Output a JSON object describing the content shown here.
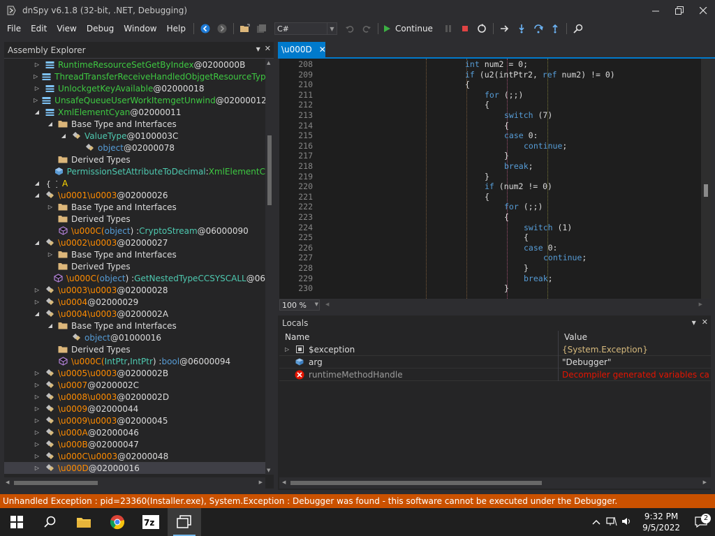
{
  "window": {
    "title": "dnSpy v6.1.8 (32-bit, .NET, Debugging)",
    "controls": [
      "minimize",
      "restore",
      "close"
    ]
  },
  "menu": [
    "File",
    "Edit",
    "View",
    "Debug",
    "Window",
    "Help"
  ],
  "toolbar": {
    "language": "C#",
    "continue_label": "Continue"
  },
  "assembly_explorer": {
    "title": "Assembly Explorer",
    "rows": [
      {
        "indent": 1,
        "tri": "▷",
        "icon": "class",
        "parts": [
          {
            "t": "RuntimeResourceSetGetByIndex",
            "c": "c-gr2"
          },
          {
            "t": " @0200000B",
            "c": "c-white"
          }
        ]
      },
      {
        "indent": 1,
        "tri": "▷",
        "icon": "class",
        "parts": [
          {
            "t": "ThreadTransferReceiveHandledObjgetResourceTypeI",
            "c": "c-gr2"
          }
        ]
      },
      {
        "indent": 1,
        "tri": "▷",
        "icon": "class",
        "parts": [
          {
            "t": "UnlockgetKeyAvailable",
            "c": "c-gr2"
          },
          {
            "t": " @02000018",
            "c": "c-white"
          }
        ]
      },
      {
        "indent": 1,
        "tri": "▷",
        "icon": "class",
        "parts": [
          {
            "t": "UnsafeQueueUserWorkItemgetUnwind",
            "c": "c-gr2"
          },
          {
            "t": " @02000012",
            "c": "c-white"
          }
        ]
      },
      {
        "indent": 1,
        "tri": "◢",
        "icon": "class",
        "parts": [
          {
            "t": "XmlElementCyan",
            "c": "c-gr2"
          },
          {
            "t": " @02000011",
            "c": "c-white"
          }
        ]
      },
      {
        "indent": 2,
        "tri": "◢",
        "icon": "folder",
        "parts": [
          {
            "t": "Base Type and Interfaces",
            "c": "c-white"
          }
        ]
      },
      {
        "indent": 3,
        "tri": "◢",
        "icon": "struct",
        "parts": [
          {
            "t": "ValueType",
            "c": "c-teal"
          },
          {
            "t": " @0100003C",
            "c": "c-white"
          }
        ]
      },
      {
        "indent": 4,
        "tri": "",
        "icon": "struct",
        "parts": [
          {
            "t": "object",
            "c": "c-blue"
          },
          {
            "t": " @02000078",
            "c": "c-white"
          }
        ]
      },
      {
        "indent": 2,
        "tri": "",
        "icon": "folder",
        "parts": [
          {
            "t": "Derived Types",
            "c": "c-white"
          }
        ]
      },
      {
        "indent": 2,
        "tri": "",
        "icon": "method",
        "parts": [
          {
            "t": "PermissionSetAttributeToDecimal",
            "c": "c-teal"
          },
          {
            "t": " : ",
            "c": "c-white"
          },
          {
            "t": "XmlElementC",
            "c": "c-gr2"
          }
        ]
      },
      {
        "indent": 0,
        "tri": "◢",
        "icon": "namespace",
        "parts": [
          {
            "t": "A",
            "c": "c-ns"
          }
        ]
      },
      {
        "indent": 1,
        "tri": "◢",
        "icon": "struct",
        "parts": [
          {
            "t": "\\u0001\\u0003",
            "c": "c-orange"
          },
          {
            "t": " @02000026",
            "c": "c-white"
          }
        ]
      },
      {
        "indent": 2,
        "tri": "▷",
        "icon": "folder",
        "parts": [
          {
            "t": "Base Type and Interfaces",
            "c": "c-white"
          }
        ]
      },
      {
        "indent": 2,
        "tri": "",
        "icon": "folder",
        "parts": [
          {
            "t": "Derived Types",
            "c": "c-white"
          }
        ]
      },
      {
        "indent": 2,
        "tri": "",
        "icon": "ctor",
        "parts": [
          {
            "t": "\\u000C(",
            "c": "c-orange"
          },
          {
            "t": "object",
            "c": "c-blue"
          },
          {
            "t": ") : ",
            "c": "c-white"
          },
          {
            "t": "CryptoStream",
            "c": "c-teal"
          },
          {
            "t": " @06000090",
            "c": "c-white"
          }
        ]
      },
      {
        "indent": 1,
        "tri": "◢",
        "icon": "struct",
        "parts": [
          {
            "t": "\\u0002\\u0003",
            "c": "c-orange"
          },
          {
            "t": " @02000027",
            "c": "c-white"
          }
        ]
      },
      {
        "indent": 2,
        "tri": "▷",
        "icon": "folder",
        "parts": [
          {
            "t": "Base Type and Interfaces",
            "c": "c-white"
          }
        ]
      },
      {
        "indent": 2,
        "tri": "",
        "icon": "folder",
        "parts": [
          {
            "t": "Derived Types",
            "c": "c-white"
          }
        ]
      },
      {
        "indent": 2,
        "tri": "",
        "icon": "ctor",
        "parts": [
          {
            "t": "\\u000C(",
            "c": "c-orange"
          },
          {
            "t": "object",
            "c": "c-blue"
          },
          {
            "t": ") : ",
            "c": "c-white"
          },
          {
            "t": "GetNestedTypeCCSYSCALL",
            "c": "c-teal"
          },
          {
            "t": " @06",
            "c": "c-white"
          }
        ]
      },
      {
        "indent": 1,
        "tri": "▷",
        "icon": "struct",
        "parts": [
          {
            "t": "\\u0003\\u0003",
            "c": "c-orange"
          },
          {
            "t": " @02000028",
            "c": "c-white"
          }
        ]
      },
      {
        "indent": 1,
        "tri": "▷",
        "icon": "struct",
        "parts": [
          {
            "t": "\\u0004",
            "c": "c-orange"
          },
          {
            "t": " @02000029",
            "c": "c-white"
          }
        ]
      },
      {
        "indent": 1,
        "tri": "◢",
        "icon": "struct",
        "parts": [
          {
            "t": "\\u0004\\u0003",
            "c": "c-orange"
          },
          {
            "t": " @0200002A",
            "c": "c-white"
          }
        ]
      },
      {
        "indent": 2,
        "tri": "◢",
        "icon": "folder",
        "parts": [
          {
            "t": "Base Type and Interfaces",
            "c": "c-white"
          }
        ]
      },
      {
        "indent": 3,
        "tri": "",
        "icon": "struct",
        "parts": [
          {
            "t": "object",
            "c": "c-blue"
          },
          {
            "t": " @01000016",
            "c": "c-white"
          }
        ]
      },
      {
        "indent": 2,
        "tri": "",
        "icon": "folder",
        "parts": [
          {
            "t": "Derived Types",
            "c": "c-white"
          }
        ]
      },
      {
        "indent": 2,
        "tri": "",
        "icon": "ctor",
        "parts": [
          {
            "t": "\\u000C(",
            "c": "c-orange"
          },
          {
            "t": "IntPtr",
            "c": "c-teal"
          },
          {
            "t": ", ",
            "c": "c-white"
          },
          {
            "t": "IntPtr",
            "c": "c-teal"
          },
          {
            "t": ") : ",
            "c": "c-white"
          },
          {
            "t": "bool",
            "c": "c-blue"
          },
          {
            "t": " @06000094",
            "c": "c-white"
          }
        ]
      },
      {
        "indent": 1,
        "tri": "▷",
        "icon": "struct",
        "parts": [
          {
            "t": "\\u0005\\u0003",
            "c": "c-orange"
          },
          {
            "t": " @0200002B",
            "c": "c-white"
          }
        ]
      },
      {
        "indent": 1,
        "tri": "▷",
        "icon": "struct",
        "parts": [
          {
            "t": "\\u0007",
            "c": "c-orange"
          },
          {
            "t": " @0200002C",
            "c": "c-white"
          }
        ]
      },
      {
        "indent": 1,
        "tri": "▷",
        "icon": "struct",
        "parts": [
          {
            "t": "\\u0008\\u0003",
            "c": "c-orange"
          },
          {
            "t": " @0200002D",
            "c": "c-white"
          }
        ]
      },
      {
        "indent": 1,
        "tri": "▷",
        "icon": "struct",
        "parts": [
          {
            "t": "\\u0009",
            "c": "c-orange"
          },
          {
            "t": " @02000044",
            "c": "c-white"
          }
        ]
      },
      {
        "indent": 1,
        "tri": "▷",
        "icon": "struct",
        "parts": [
          {
            "t": "\\u0009\\u0003",
            "c": "c-orange"
          },
          {
            "t": " @02000045",
            "c": "c-white"
          }
        ]
      },
      {
        "indent": 1,
        "tri": "▷",
        "icon": "struct",
        "parts": [
          {
            "t": "\\u000A",
            "c": "c-orange"
          },
          {
            "t": " @02000046",
            "c": "c-white"
          }
        ]
      },
      {
        "indent": 1,
        "tri": "▷",
        "icon": "struct",
        "parts": [
          {
            "t": "\\u000B",
            "c": "c-orange"
          },
          {
            "t": " @02000047",
            "c": "c-white"
          }
        ]
      },
      {
        "indent": 1,
        "tri": "▷",
        "icon": "struct",
        "parts": [
          {
            "t": "\\u000C\\u0003",
            "c": "c-orange"
          },
          {
            "t": " @02000048",
            "c": "c-white"
          }
        ]
      },
      {
        "indent": 1,
        "tri": "▷",
        "icon": "struct",
        "selected": true,
        "parts": [
          {
            "t": "\\u000D",
            "c": "c-orange"
          },
          {
            "t": " @02000016",
            "c": "c-white"
          }
        ]
      }
    ]
  },
  "editor": {
    "tab_label": "\\u000D",
    "zoom": "100 %",
    "lines": [
      {
        "n": "208",
        "indent": 0,
        "segs": [
          {
            "t": "int",
            "k": 1
          },
          {
            "t": " num2 = 0;"
          }
        ]
      },
      {
        "n": "209",
        "indent": 0,
        "segs": [
          {
            "t": "if",
            "k": 1
          },
          {
            "t": " (u2(intPtr2, "
          },
          {
            "t": "ref",
            "k": 1
          },
          {
            "t": " num2) != 0)"
          }
        ]
      },
      {
        "n": "210",
        "indent": 0,
        "segs": [
          {
            "t": "{"
          }
        ]
      },
      {
        "n": "211",
        "indent": 1,
        "segs": [
          {
            "t": "for",
            "k": 1
          },
          {
            "t": " (;;)"
          }
        ]
      },
      {
        "n": "212",
        "indent": 1,
        "segs": [
          {
            "t": "{"
          }
        ]
      },
      {
        "n": "213",
        "indent": 2,
        "segs": [
          {
            "t": "switch",
            "k": 1
          },
          {
            "t": " (7)"
          }
        ]
      },
      {
        "n": "214",
        "indent": 2,
        "segs": [
          {
            "t": "{"
          }
        ]
      },
      {
        "n": "215",
        "indent": 2,
        "segs": [
          {
            "t": "case",
            "k": 1
          },
          {
            "t": " 0:"
          }
        ]
      },
      {
        "n": "216",
        "indent": 3,
        "segs": [
          {
            "t": "continue",
            "k": 1
          },
          {
            "t": ";"
          }
        ]
      },
      {
        "n": "217",
        "indent": 2,
        "segs": [
          {
            "t": "}"
          }
        ]
      },
      {
        "n": "218",
        "indent": 2,
        "segs": [
          {
            "t": "break",
            "k": 1
          },
          {
            "t": ";"
          }
        ]
      },
      {
        "n": "219",
        "indent": 1,
        "segs": [
          {
            "t": "}"
          }
        ]
      },
      {
        "n": "220",
        "indent": 1,
        "segs": [
          {
            "t": "if",
            "k": 1
          },
          {
            "t": " (num2 != 0)"
          }
        ]
      },
      {
        "n": "221",
        "indent": 1,
        "segs": [
          {
            "t": "{"
          }
        ]
      },
      {
        "n": "222",
        "indent": 2,
        "segs": [
          {
            "t": "for",
            "k": 1
          },
          {
            "t": " (;;)"
          }
        ]
      },
      {
        "n": "223",
        "indent": 2,
        "segs": [
          {
            "t": "{"
          }
        ]
      },
      {
        "n": "224",
        "indent": 3,
        "segs": [
          {
            "t": "switch",
            "k": 1
          },
          {
            "t": " (1)"
          }
        ]
      },
      {
        "n": "225",
        "indent": 3,
        "segs": [
          {
            "t": "{"
          }
        ]
      },
      {
        "n": "226",
        "indent": 3,
        "segs": [
          {
            "t": "case",
            "k": 1
          },
          {
            "t": " 0:"
          }
        ]
      },
      {
        "n": "227",
        "indent": 4,
        "segs": [
          {
            "t": "continue",
            "k": 1
          },
          {
            "t": ";"
          }
        ]
      },
      {
        "n": "228",
        "indent": 3,
        "segs": [
          {
            "t": "}"
          }
        ]
      },
      {
        "n": "229",
        "indent": 3,
        "segs": [
          {
            "t": "break",
            "k": 1
          },
          {
            "t": ";"
          }
        ]
      },
      {
        "n": "230",
        "indent": 2,
        "segs": [
          {
            "t": "}"
          }
        ]
      }
    ]
  },
  "locals": {
    "title": "Locals",
    "col_name": "Name",
    "col_value": "Value",
    "rows": [
      {
        "name": "$exception",
        "value": "{System.Exception}",
        "icon": "exception",
        "expand": true
      },
      {
        "name": "arg",
        "value": "\"Debugger\"",
        "icon": "field",
        "expand": false
      },
      {
        "name": "runtimeMethodHandle",
        "value": "Decompiler generated variables can't be",
        "icon": "error",
        "expand": false
      }
    ]
  },
  "statusbar": {
    "message": "Unhandled Exception : pid=23360(Installer.exe), System.Exception : Debugger was found - this software cannot be executed under the Debugger."
  },
  "taskbar": {
    "apps": [
      "start",
      "search",
      "file-explorer",
      "chrome",
      "7zip",
      "dnspy"
    ],
    "time": "9:32 PM",
    "date": "9/5/2022",
    "notifications": "2"
  }
}
